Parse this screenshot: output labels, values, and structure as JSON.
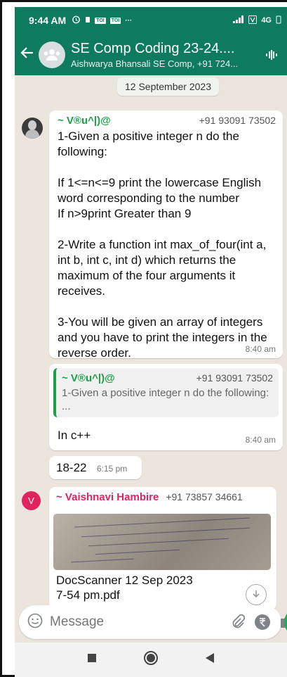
{
  "status": {
    "time": "9:44 AM",
    "network": "4G"
  },
  "header": {
    "title": "SE Comp Coding 23-24....",
    "subtitle": "Aishwarya Bhansali SE Comp, +91 724..."
  },
  "chat": {
    "date_divider": "12 September 2023",
    "messages": [
      {
        "sender": "~ V®u^|)@",
        "phone": "+91 93091 73502",
        "text": "1-Given a positive integer n do the following:\n\nIf 1<=n<=9 print the lowercase English word corresponding to the number\nIf n>9print Greater than 9\n\n2-Write a function int max_of_four(int a, int b, int c, int d) which returns the maximum of the four arguments it receives.\n\n3-You will be given an array of integers and you have to print the integers in the reverse order.",
        "time": "8:40 am"
      },
      {
        "quote_sender": "~ V®u^|)@",
        "quote_phone": "+91 93091 73502",
        "quote_text": "1-Given a positive integer n do the following:\n...",
        "text": "In c++",
        "time": "8:40 am"
      },
      {
        "text": "18-22",
        "time": "6:15 pm"
      },
      {
        "avatar_letter": "V",
        "sender": "~ Vaishnavi Hambire",
        "phone": "+91 73857 34661",
        "doc_name": "DocScanner 12 Sep 2023\n7-54 pm.pdf"
      }
    ]
  },
  "composer": {
    "placeholder": "Message"
  },
  "colors": {
    "header": "#0e7b5f",
    "sender_green": "#1f9e48",
    "sender_pink": "#e0245e",
    "wallpaper": "#ece5dd"
  }
}
